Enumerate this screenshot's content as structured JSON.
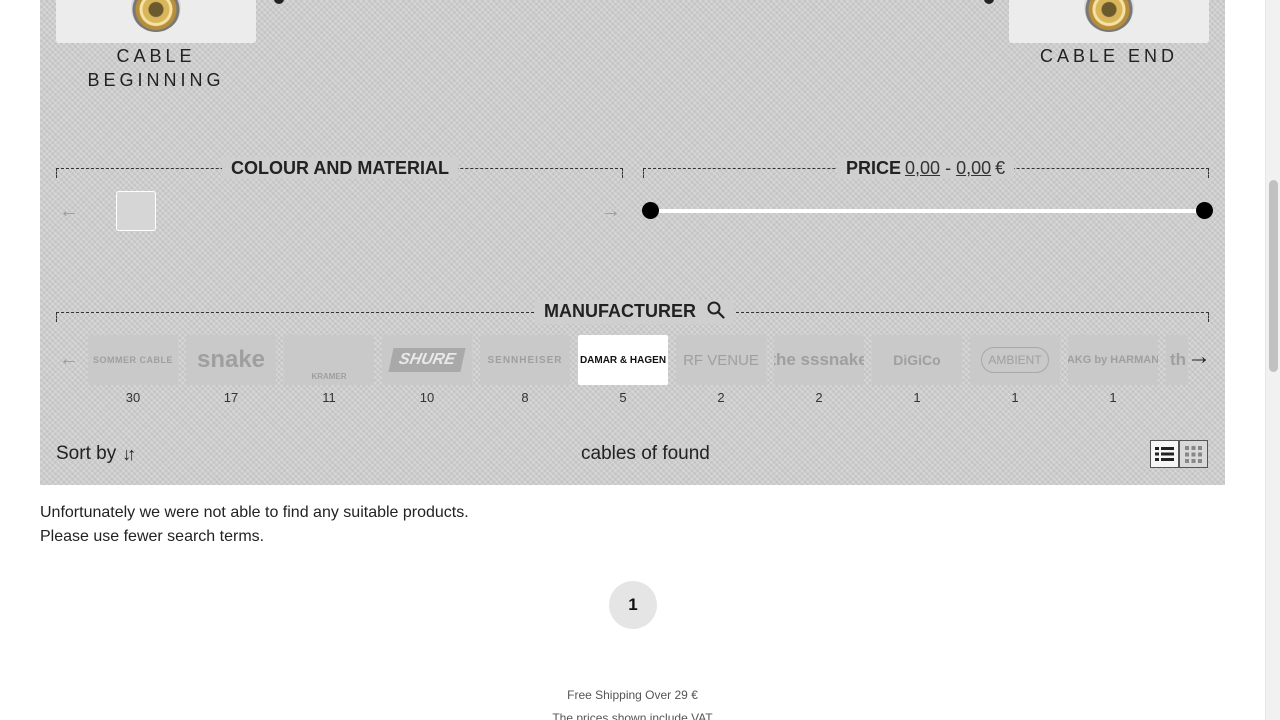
{
  "cable": {
    "beginning_label": "CABLE BEGINNING",
    "end_label": "CABLE END"
  },
  "colour": {
    "legend": "COLOUR AND MATERIAL",
    "prev_arrow": "←",
    "next_arrow": "→"
  },
  "price": {
    "legend": "PRICE",
    "min": "0,00",
    "sep": "-",
    "max": "0,00",
    "currency": "€"
  },
  "manufacturer": {
    "legend": "MANUFACTURER",
    "prev_arrow": "←",
    "next_arrow": "→",
    "items": [
      {
        "name": "SOMMER CABLE",
        "count": "30"
      },
      {
        "name": "snake",
        "count": "17"
      },
      {
        "name": "KRAMER",
        "count": "11"
      },
      {
        "name": "SHURE",
        "count": "10"
      },
      {
        "name": "SENNHEISER",
        "count": "8"
      },
      {
        "name": "DAMAR & HAGEN",
        "count": "5",
        "selected": true
      },
      {
        "name": "RF VENUE",
        "count": "2"
      },
      {
        "name": "the sssnake",
        "count": "2"
      },
      {
        "name": "DiGiCo",
        "count": "1"
      },
      {
        "name": "AMBIENT",
        "count": "1"
      },
      {
        "name": "AKG by HARMAN",
        "count": "1"
      },
      {
        "name": "th",
        "count": ""
      }
    ]
  },
  "toolbar": {
    "sort_label": "Sort by",
    "found_text": "cables of found",
    "view_list": "list-view",
    "view_grid": "grid-view"
  },
  "results": {
    "line1": "Unfortunately we were not able to find any suitable products.",
    "line2": "Please use fewer search terms."
  },
  "pagination": {
    "current": "1"
  },
  "footer": {
    "shipping": "Free Shipping Over 29 €",
    "vat": "The prices shown include VAT"
  },
  "colors": {
    "panel": "#cfcfcf",
    "selected_tile": "#ffffff",
    "slider_handle": "#000000"
  }
}
